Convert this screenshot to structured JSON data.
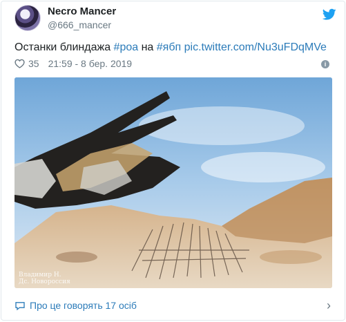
{
  "author": {
    "display_name": "Necro Mancer",
    "handle": "@666_mancer"
  },
  "tweet": {
    "text_main": "Останки блиндажа ",
    "hashtag_1": "#роа",
    "text_mid": " на ",
    "hashtag_2": "#ябп",
    "text_sp": " ",
    "pic_link": "pic.twitter.com/Nu3uFDqMVe"
  },
  "meta": {
    "likes": "35",
    "timestamp": "21:59 - 8 бер. 2019",
    "info_icon": "info-icon"
  },
  "photo": {
    "caption_line1": "Владимир Н.",
    "caption_line2": "Дс. Новороссия"
  },
  "footer": {
    "discussion_label": "Про це говорять 17 осіб",
    "chevron": "›"
  },
  "colors": {
    "link": "#2b7bb9",
    "muted": "#697882",
    "twitter_blue": "#1da1f2"
  }
}
